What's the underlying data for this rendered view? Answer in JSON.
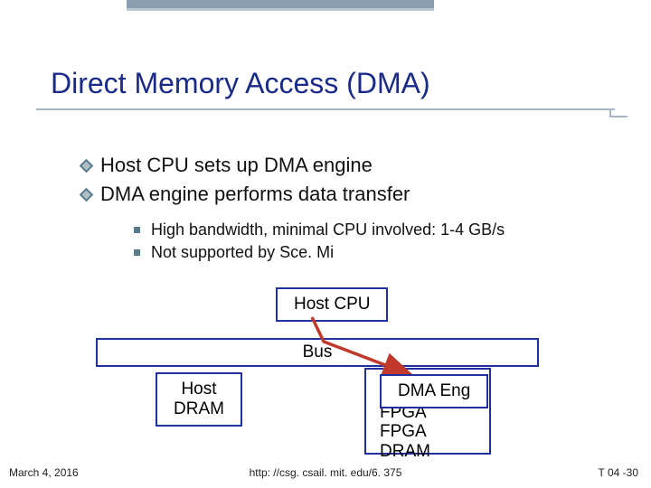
{
  "title": "Direct Memory Access (DMA)",
  "bullets": [
    "Host CPU sets up DMA engine",
    "DMA engine performs data transfer"
  ],
  "subbullets": [
    "High bandwidth, minimal CPU involved: 1-4 GB/s",
    "Not supported by Sce. Mi"
  ],
  "diagram": {
    "hostcpu": "Host CPU",
    "bus": "Bus",
    "hostdram_l1": "Host",
    "hostdram_l2": "DRAM",
    "dmaeng": "DMA Eng",
    "fpga_l1": "FPGA",
    "fpga_l2": "FPGA",
    "fpga_l3": "DRAM"
  },
  "footer": {
    "date": "March 4, 2016",
    "url": "http: //csg. csail. mit. edu/6. 375",
    "slide": "T 04 -30"
  }
}
